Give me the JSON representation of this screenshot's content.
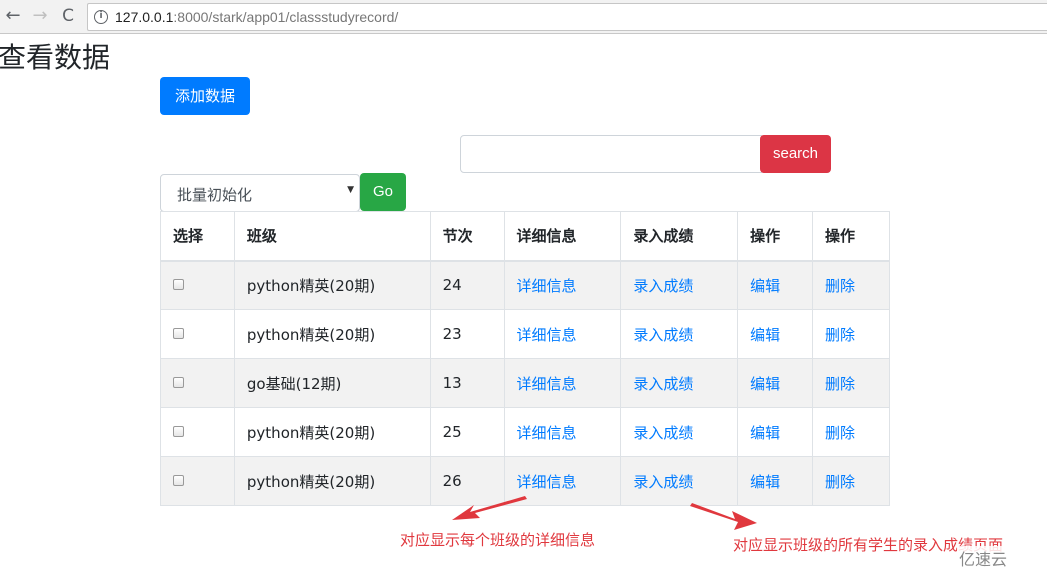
{
  "browser": {
    "back_icon": "←",
    "forward_icon": "→",
    "reload_icon": "C",
    "info_icon": "i",
    "url_host": "127.0.0.1",
    "url_rest": ":8000/stark/app01/classstudyrecord/"
  },
  "page": {
    "title": "查看数据",
    "add_button": "添加数据",
    "search": {
      "value": "",
      "placeholder": "",
      "button": "search"
    },
    "bulk_action": {
      "selected": "批量初始化",
      "caret": "▼",
      "go_button": "Go"
    }
  },
  "table": {
    "headers": [
      "选择",
      "班级",
      "节次",
      "详细信息",
      "录入成绩",
      "操作",
      "操作"
    ],
    "rows": [
      {
        "class_name": "python精英(20期)",
        "session": "24",
        "detail": "详细信息",
        "score": "录入成绩",
        "edit": "编辑",
        "delete": "删除"
      },
      {
        "class_name": "python精英(20期)",
        "session": "23",
        "detail": "详细信息",
        "score": "录入成绩",
        "edit": "编辑",
        "delete": "删除"
      },
      {
        "class_name": "go基础(12期)",
        "session": "13",
        "detail": "详细信息",
        "score": "录入成绩",
        "edit": "编辑",
        "delete": "删除"
      },
      {
        "class_name": "python精英(20期)",
        "session": "25",
        "detail": "详细信息",
        "score": "录入成绩",
        "edit": "编辑",
        "delete": "删除"
      },
      {
        "class_name": "python精英(20期)",
        "session": "26",
        "detail": "详细信息",
        "score": "录入成绩",
        "edit": "编辑",
        "delete": "删除"
      }
    ]
  },
  "annotations": {
    "detail_note": "对应显示每个班级的详细信息",
    "score_note": "对应显示班级的所有学生的录入成绩页面",
    "color": "#e0383e"
  },
  "watermark": "亿速云",
  "colors": {
    "primary": "#007bff",
    "danger": "#dc3545",
    "success": "#28a745"
  }
}
